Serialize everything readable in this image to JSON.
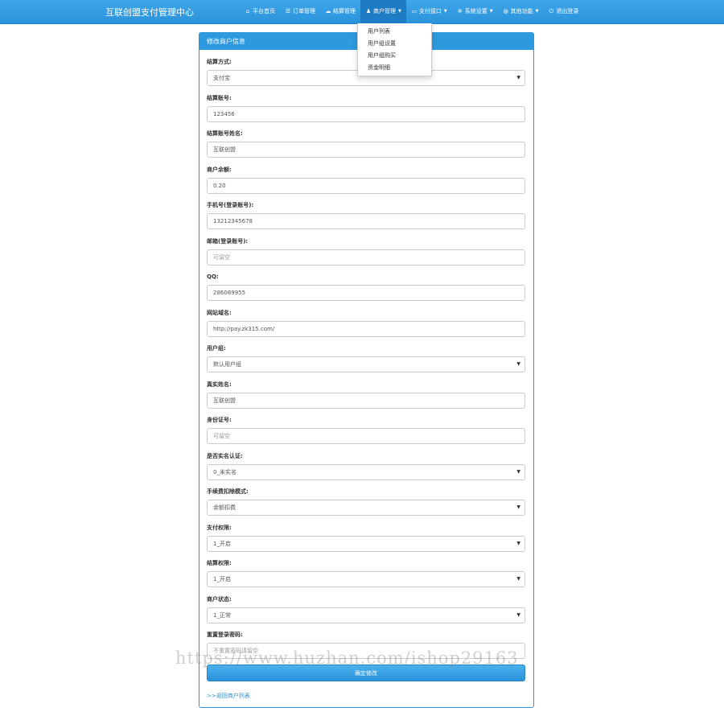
{
  "nav": {
    "brand": "互联创盟支付管理中心",
    "items": [
      {
        "name": "nav-home",
        "icon": "home-icon",
        "glyph": "⌂",
        "label": "平台首页",
        "dropdown": false,
        "active": false
      },
      {
        "name": "nav-orders",
        "icon": "list-icon",
        "glyph": "☰",
        "label": "订单管理",
        "dropdown": false,
        "active": false
      },
      {
        "name": "nav-settlement",
        "icon": "cloud-icon",
        "glyph": "☁",
        "label": "结算管理",
        "dropdown": false,
        "active": false
      },
      {
        "name": "nav-merchants",
        "icon": "user-icon",
        "glyph": "♟",
        "label": "商户管理",
        "dropdown": true,
        "active": true
      },
      {
        "name": "nav-payment",
        "icon": "card-icon",
        "glyph": "▭",
        "label": "支付接口",
        "dropdown": true,
        "active": false
      },
      {
        "name": "nav-settings",
        "icon": "gear-icon",
        "glyph": "✲",
        "label": "系统设置",
        "dropdown": true,
        "active": false
      },
      {
        "name": "nav-other",
        "icon": "globe-icon",
        "glyph": "◍",
        "label": "其他功能",
        "dropdown": true,
        "active": false
      },
      {
        "name": "nav-logout",
        "icon": "power-icon",
        "glyph": "⏻",
        "label": "退出登录",
        "dropdown": false,
        "active": false
      }
    ]
  },
  "dropdown": {
    "items": [
      "用户列表",
      "用户组设置",
      "用户组购买",
      "资金明细"
    ]
  },
  "panel": {
    "title": "修改商户信息",
    "fields": [
      {
        "label": "结算方式:",
        "value": "支付宝",
        "type": "select",
        "placeholder": false
      },
      {
        "label": "结算账号:",
        "value": "123456",
        "type": "input",
        "placeholder": false
      },
      {
        "label": "结算账号姓名:",
        "value": "互联创盟",
        "type": "input",
        "placeholder": false
      },
      {
        "label": "商户余额:",
        "value": "0.20",
        "type": "input",
        "placeholder": false
      },
      {
        "label": "手机号(登录账号):",
        "value": "13212345678",
        "type": "input",
        "placeholder": false
      },
      {
        "label": "邮箱(登录账号):",
        "value": "可留空",
        "type": "input",
        "placeholder": true
      },
      {
        "label": "QQ:",
        "value": "286069955",
        "type": "input",
        "placeholder": false
      },
      {
        "label": "网站域名:",
        "value": "http://pay.zk315.com/",
        "type": "input",
        "placeholder": false
      },
      {
        "label": "用户组:",
        "value": "默认用户组",
        "type": "select",
        "placeholder": false
      },
      {
        "label": "真实姓名:",
        "value": "互联创盟",
        "type": "input",
        "placeholder": false
      },
      {
        "label": "身份证号:",
        "value": "可留空",
        "type": "input",
        "placeholder": true
      },
      {
        "label": "是否实名认证:",
        "value": "0_未实名",
        "type": "select",
        "placeholder": false
      },
      {
        "label": "手续费扣除模式:",
        "value": "余额扣费",
        "type": "select",
        "placeholder": false
      },
      {
        "label": "支付权限:",
        "value": "1_开启",
        "type": "select",
        "placeholder": false
      },
      {
        "label": "结算权限:",
        "value": "1_开启",
        "type": "select",
        "placeholder": false
      },
      {
        "label": "商户状态:",
        "value": "1_正常",
        "type": "select",
        "placeholder": false
      },
      {
        "label": "重置登录密码:",
        "value": "不重置密码请留空",
        "type": "input",
        "placeholder": true
      }
    ],
    "submit_label": "确定修改",
    "back_link": ">>返回商户列表"
  },
  "watermark": "https://www.huzhan.com/ishop29163"
}
